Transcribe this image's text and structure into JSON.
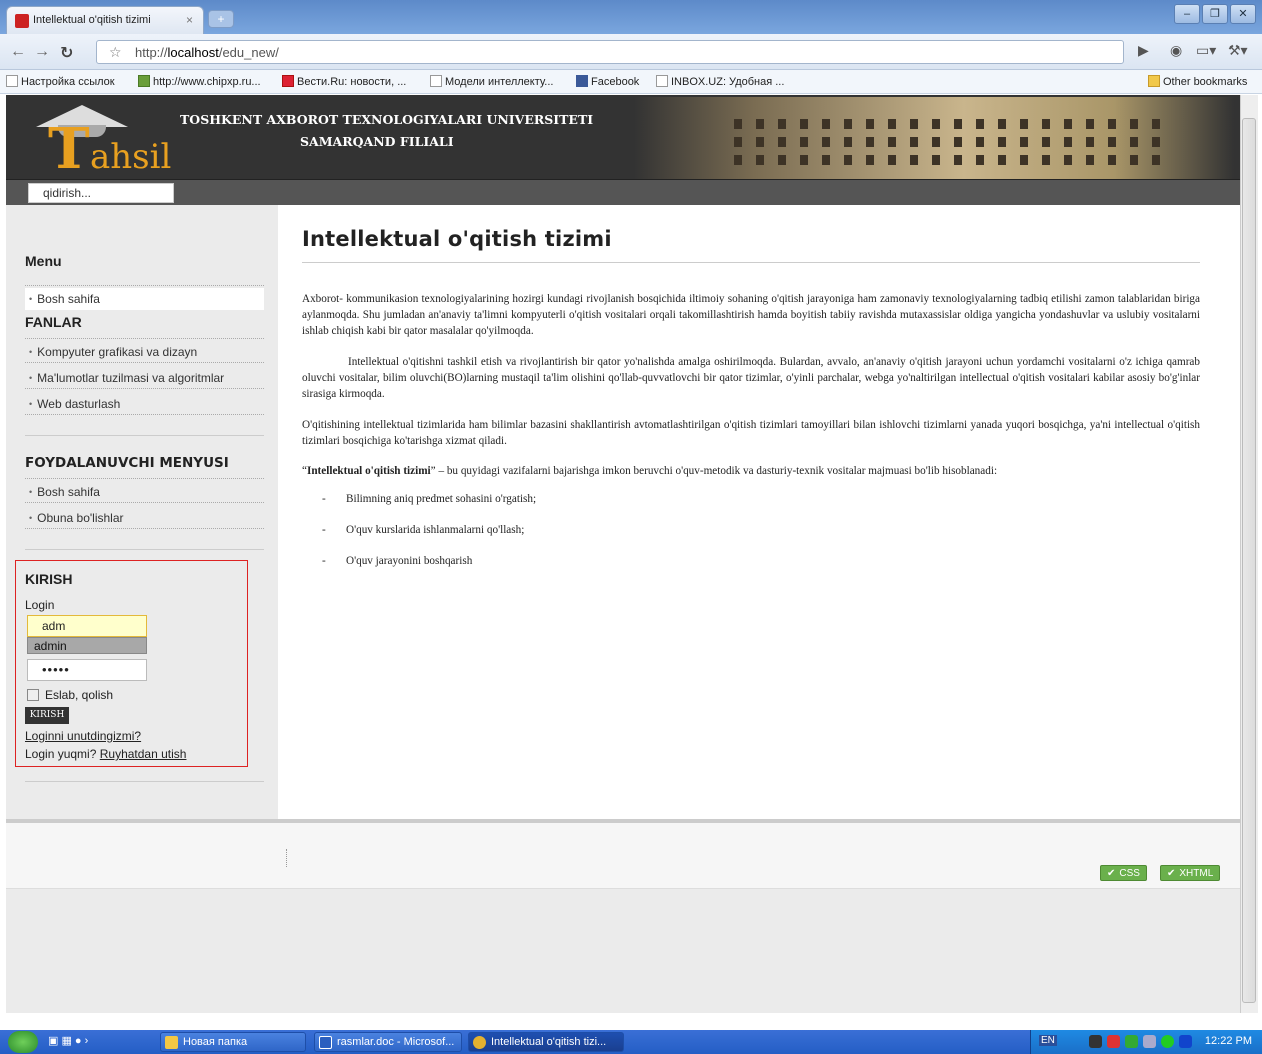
{
  "browser": {
    "tab_title": "Intellektual o'qitish tizimi",
    "tab_close": "×",
    "new_tab": "+",
    "url_prefix": "http://",
    "url_host": "localhost",
    "url_path": "/edu_new/",
    "bookmarks": [
      "Настройка ссылок",
      "http://www.chipxp.ru...",
      "Вести.Ru: новости, ...",
      "Модели интеллекту...",
      "Facebook",
      "INBOX.UZ: Удобная ..."
    ],
    "other_bookmarks": "Other bookmarks"
  },
  "header": {
    "logo_first": "T",
    "logo_rest": "ahsil",
    "univ_line1": "TOSHKENT AXBOROT TEXNOLOGIYALARI UNIVERSITETI",
    "univ_line2": "SAMARQAND FILIALI",
    "search_placeholder": "qidirish..."
  },
  "sidebar": {
    "menu_title": "Menu",
    "menu_items": [
      "Bosh sahifa"
    ],
    "fanlar_title": "FANLAR",
    "fanlar_items": [
      "Kompyuter grafikasi va dizayn",
      "Ma'lumotlar tuzilmasi va algoritmlar",
      "Web dasturlash"
    ],
    "user_menu_title": "FOYDALANUVCHI MENYUSI",
    "user_menu_items": [
      "Bosh sahifa",
      "Obuna bo'lishlar"
    ]
  },
  "login": {
    "title": "KIRISH",
    "login_label": "Login",
    "login_value": "adm",
    "autocomplete": "admin",
    "password_mask": "•••••",
    "remember_label": "Eslab, qolish",
    "submit": "KIRISH",
    "forgot": "Loginni unutdingizmi?",
    "no_login": "Login yuqmi?",
    "register": "Ruyhatdan utish"
  },
  "content": {
    "title": "Intellektual o'qitish tizimi",
    "p1": "Axborot- kommunikasion texnologiyalarining hozirgi kundagi rivojlanish bosqichida iltimoiy sohaning o'qitish jarayoniga ham zamonaviy texnologiyalarning tadbiq etilishi zamon talablaridan biriga aylanmoqda. Shu jumladan an'anaviy ta'limni kompyuterli o'qitish vositalari orqali takomillashtirish hamda boyitish tabiiy ravishda mutaxassislar oldiga yangicha yondashuvlar va uslubiy vositalarni ishlab chiqish kabi bir qator masalalar qo'yilmoqda.",
    "p2": "Intellektual o'qitishni tashkil etish va rivojlantirish bir qator yo'nalishda amalga oshirilmoqda. Bulardan, avvalo, an'anaviy o'qitish jarayoni uchun yordamchi vositalarni o'z ichiga qamrab oluvchi vositalar, bilim oluvchi(BO)larning mustaqil ta'lim olishini qo'llab-quvvatlovchi bir qator tizimlar, o'yinli parchalar, webga yo'naltirilgan intellectual o'qitish vositalari kabilar asosiy bo'g'inlar sirasiga kirmoqda.",
    "p3": "O'qitishining intellektual tizimlarida ham bilimlar bazasini shakllantirish avtomatlashtirilgan o'qitish tizimlari tamoyillari bilan ishlovchi tizimlarni yanada yuqori bosqichga, ya'ni intellectual o'qitish tizimlari bosqichiga ko'tarishga xizmat qiladi.",
    "p4_bold": "Intellektual o'qitish tizimi",
    "p4_rest": " – bu quyidagi vazifalarni bajarishga imkon beruvchi o'quv-metodik va dasturiy-texnik vositalar majmuasi bo'lib hisoblanadi:",
    "list": [
      "Bilimning aniq predmet sohasini o'rgatish;",
      "O'quv kurslarida ishlanmalarni qo'llash;",
      "O'quv jarayonini boshqarish"
    ]
  },
  "footer": {
    "css_badge": "CSS",
    "xhtml_badge": "XHTML"
  },
  "taskbar": {
    "items": [
      "Новая папка",
      "rasmlar.doc - Microsof...",
      "Intellektual o'qitish tizi..."
    ],
    "lang": "EN",
    "clock": "12:22 PM"
  },
  "colors": {
    "accent": "#e8a020",
    "header_bg": "#333333",
    "login_border": "#dd2222"
  }
}
